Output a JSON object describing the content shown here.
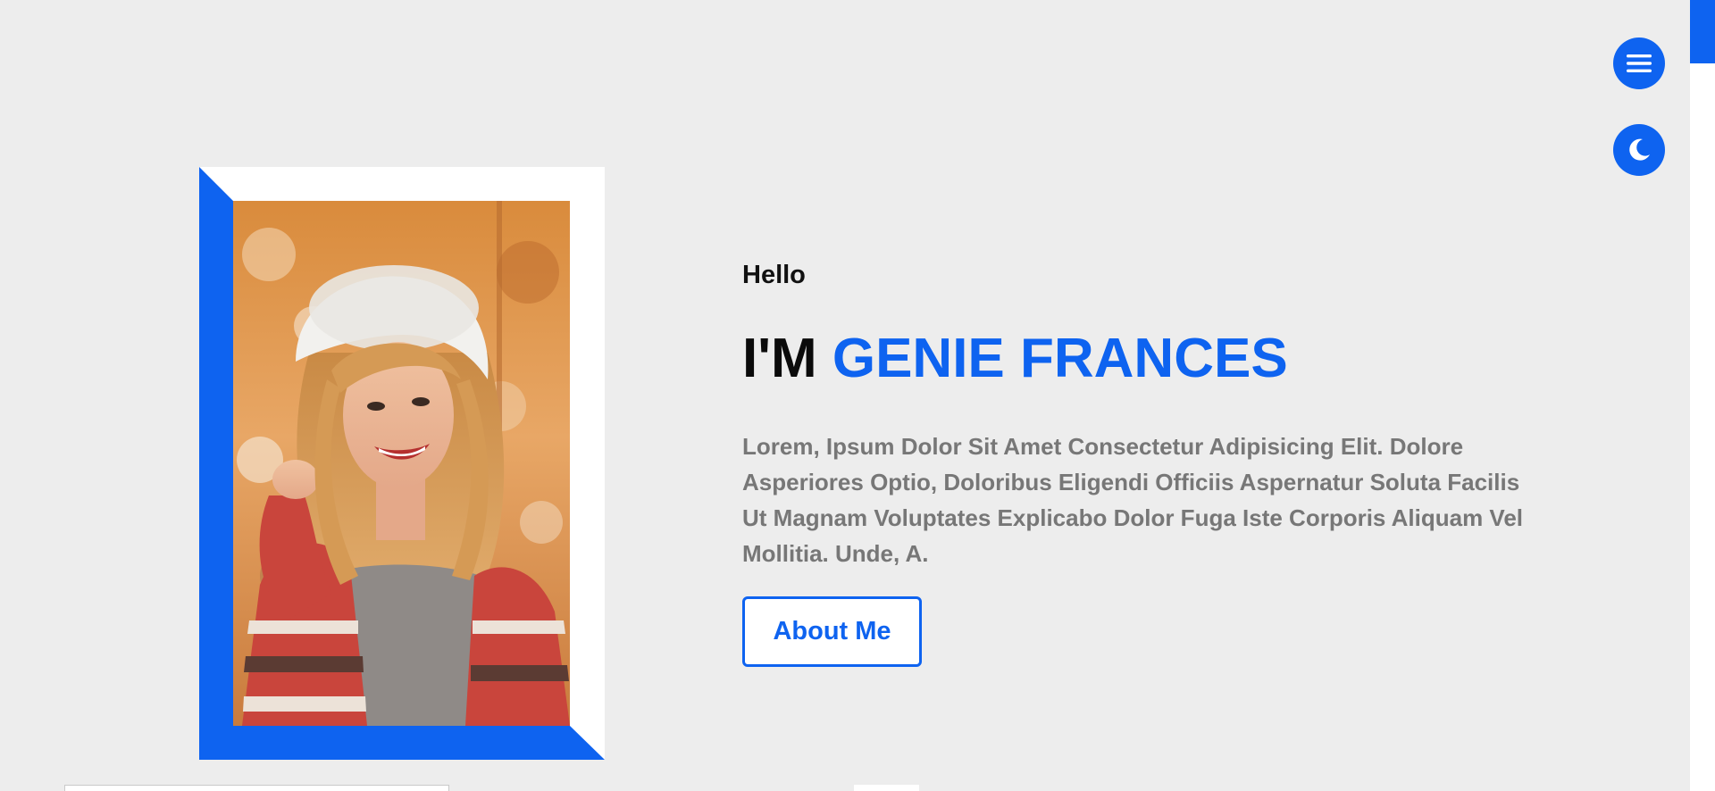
{
  "colors": {
    "accent": "#0e63f0",
    "background": "#ededed",
    "heading": "#0b0b0b",
    "body_text": "#777777",
    "card": "#ffffff"
  },
  "controls": {
    "menu_icon": "hamburger-menu-icon",
    "theme_icon": "moon-icon"
  },
  "hero": {
    "greeting": "Hello",
    "name_prefix": "I'M ",
    "name_highlight": "GENIE FRANCES",
    "description": "Lorem, Ipsum Dolor Sit Amet Consectetur Adipisicing Elit. Dolore Asperiores Optio, Doloribus Eligendi Officiis Aspernatur Soluta Facilis Ut Magnam Voluptates Explicabo Dolor Fuga Iste Corporis Aliquam Vel Mollitia. Unde, A.",
    "cta_label": "About Me"
  },
  "portrait": {
    "subject": "smiling woman with wavy blonde hair in a white knit hat and striped cardigan, autumn background"
  }
}
